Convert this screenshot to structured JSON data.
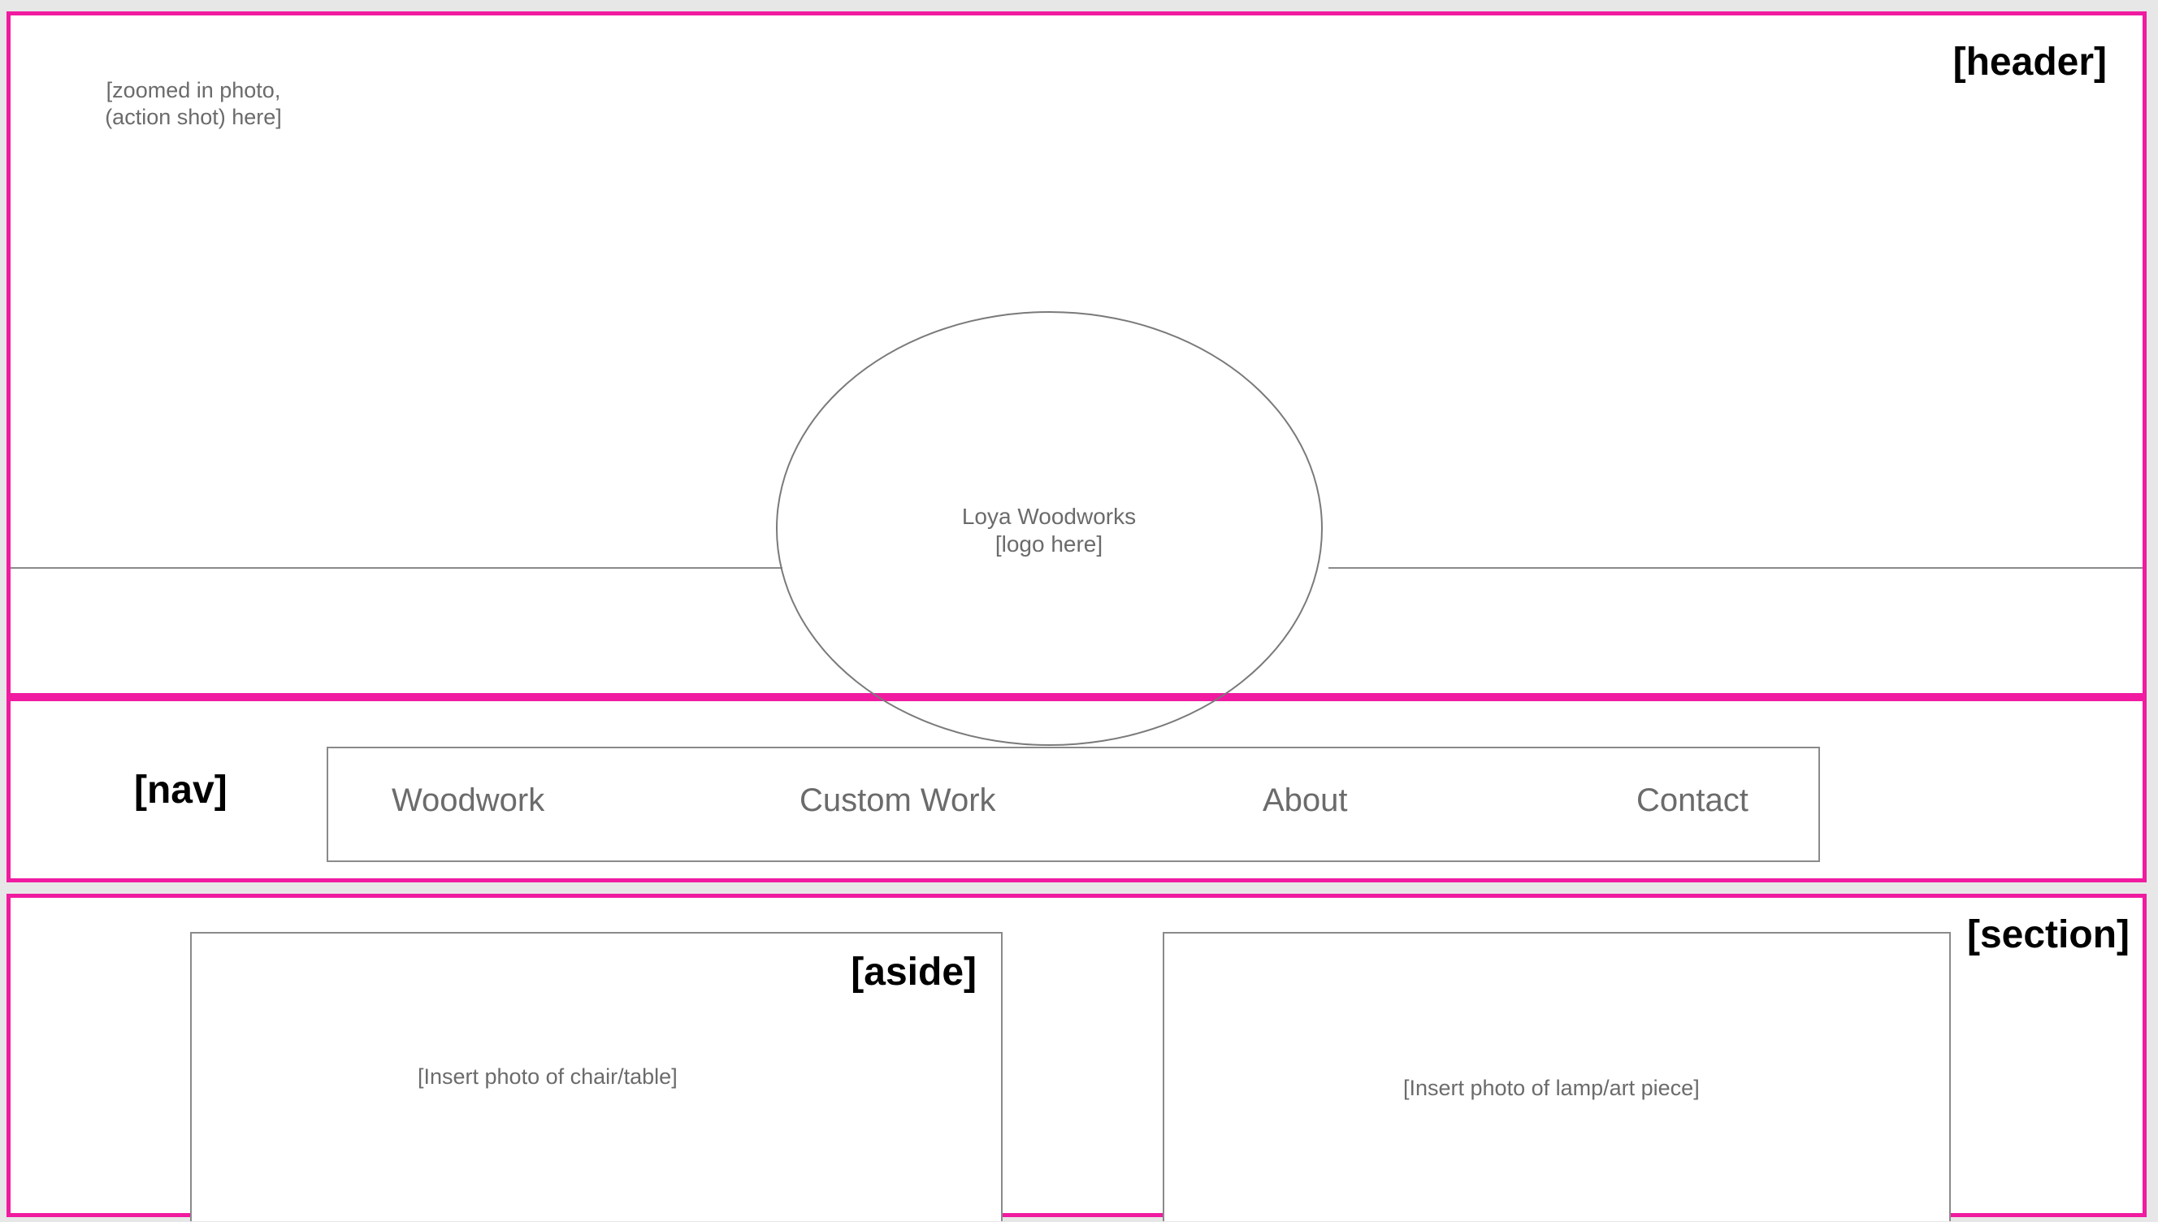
{
  "header": {
    "label": "[header]",
    "photo_placeholder_line1": "[zoomed in photo,",
    "photo_placeholder_line2": "(action shot) here]",
    "logo": {
      "name": "Loya Woodworks",
      "note": "[logo here]"
    }
  },
  "nav": {
    "label": "[nav]",
    "items": [
      {
        "label": "Woodwork"
      },
      {
        "label": "Custom Work"
      },
      {
        "label": "About"
      },
      {
        "label": "Contact"
      }
    ]
  },
  "section": {
    "label": "[section]",
    "aside": {
      "label": "[aside]",
      "photo_placeholder": "[Insert photo of chair/table]"
    },
    "right_photo_placeholder": "[Insert photo of lamp/art piece]"
  },
  "colors": {
    "region_border": "#f01ba0",
    "wire": "#8a8a8a",
    "placeholder_text": "#6b6b6b",
    "background": "#e7e7e7"
  }
}
